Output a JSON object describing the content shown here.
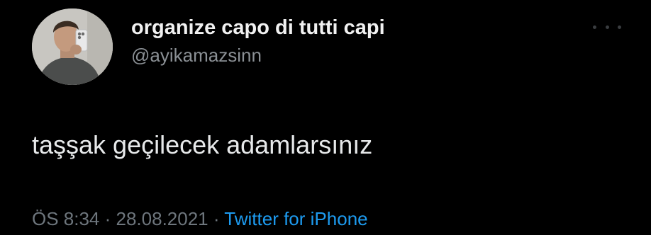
{
  "tweet": {
    "author": {
      "display_name": "organize capo di tutti capi",
      "handle": "@ayikamazsinn"
    },
    "more_icon": "more-horizontal-icon",
    "text": "taşşak geçilecek adamlarsınız",
    "time": "ÖS 8:34",
    "separator_1": " · ",
    "date": "28.08.2021",
    "separator_2": " · ",
    "source": "Twitter for iPhone",
    "colors": {
      "background": "#000000",
      "name": "#f1f1f1",
      "handle": "#8b9095",
      "meta": "#6e767d",
      "source_link": "#1d9bf0"
    }
  }
}
